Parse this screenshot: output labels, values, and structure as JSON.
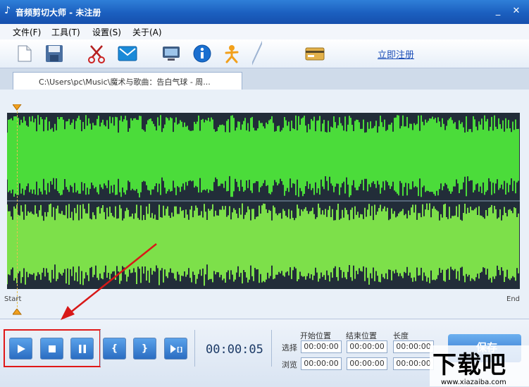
{
  "window": {
    "title": "音频剪切大师 - 未注册",
    "controls": [
      "_",
      "✕"
    ]
  },
  "menu": [
    "文件(F)",
    "工具(T)",
    "设置(S)",
    "关于(A)"
  ],
  "toolbar": {
    "icons": [
      "new-file-icon",
      "save-icon",
      "scissors-icon",
      "mail-icon",
      "monitor-icon",
      "info-icon",
      "user-icon",
      "credit-card-icon"
    ],
    "register_label": "立即注册"
  },
  "file_tab": {
    "label": "C:\\Users\\pc\\Music\\魔术与歌曲：告白气球 - 周..."
  },
  "waveform": {
    "start_label": "Start",
    "end_label": "End",
    "color": "#4bdc3a",
    "background": "#222d39"
  },
  "controls": {
    "buttons": [
      "play-icon",
      "stop-icon",
      "pause-icon",
      "mark-start-icon",
      "mark-end-icon",
      "play-selection-icon"
    ],
    "time": "00:00:05",
    "headers": {
      "start": "开始位置",
      "end": "结束位置",
      "length": "长度"
    },
    "rows": [
      {
        "label": "选择",
        "start": "00:00:00",
        "end": "00:00:00",
        "length": "00:00:00"
      },
      {
        "label": "浏览",
        "start": "00:00:00",
        "end": "00:00:00",
        "length": "00:00:00"
      }
    ],
    "save_label": "保存"
  },
  "watermark": {
    "brand": "下载吧",
    "url": "www.xiazaiba.com"
  }
}
